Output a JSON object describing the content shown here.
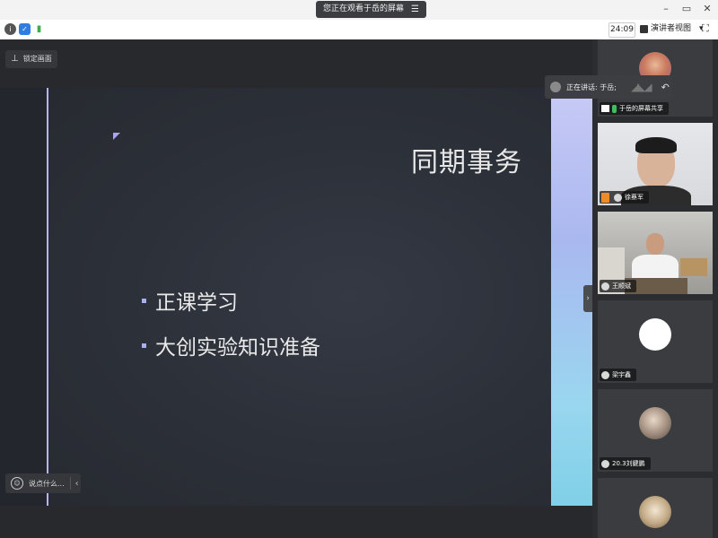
{
  "titlebar": {
    "share_notice": "您正在观看于岳的屏幕",
    "menu_icon": "hamburger-icon",
    "minimize": "–",
    "restore": "▭",
    "close": "✕"
  },
  "toolbar": {
    "timer": "24:09",
    "view_label": "演讲者视图",
    "view_dropdown": "▾",
    "fullscreen": "⛶"
  },
  "main": {
    "pin_label": "锁定画面",
    "chat_placeholder": "说点什么...",
    "chat_chevron": "‹",
    "collapse_chevron": "›"
  },
  "slide": {
    "title": "同期事务",
    "bullets": [
      "正课学习",
      "大创实验知识准备"
    ],
    "accent_color": "#b8b4f0"
  },
  "speaking": {
    "prefix": "正在讲话: 于岳;",
    "wave": "◢◣◢",
    "back": "↶"
  },
  "participants": [
    {
      "name": "于岳的屏幕共享",
      "type": "screen-share"
    },
    {
      "name": "徐蔡军",
      "type": "video"
    },
    {
      "name": "王顺斌",
      "type": "video"
    },
    {
      "name": "梁宇鑫",
      "type": "avatar"
    },
    {
      "name": "20.3刘鍵鹏",
      "type": "avatar"
    },
    {
      "name": "",
      "type": "avatar"
    }
  ]
}
